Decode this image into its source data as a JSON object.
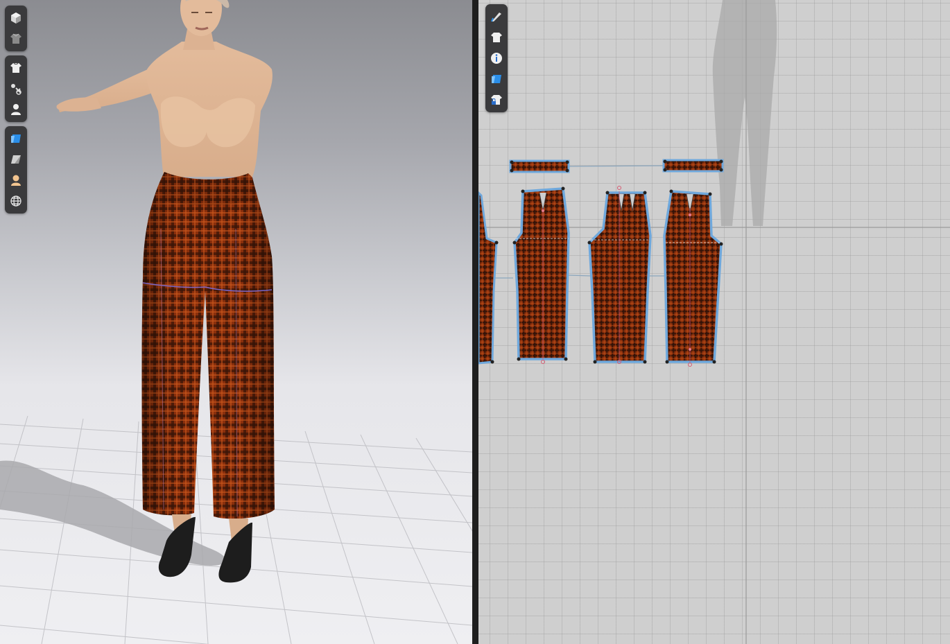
{
  "viewport_3d": {
    "toolbar_groups": [
      {
        "icons": [
          "3d-cube-display-icon",
          "garment-display-icon"
        ]
      },
      {
        "icons": [
          "show-garment-icon",
          "pin-tool-icon",
          "show-avatar-icon"
        ]
      },
      {
        "icons": [
          "texture-display-icon",
          "fabric-surface-icon",
          "avatar-skin-icon",
          "environment-globe-icon"
        ]
      }
    ]
  },
  "viewport_2d": {
    "toolbar_icons": [
      "edit-pattern-icon",
      "show-garment-2d-icon",
      "info-icon",
      "texture-2d-icon",
      "lock-garment-icon"
    ]
  },
  "colors": {
    "fabric_base": "#8a2f0c",
    "fabric_dark": "#2a1208",
    "fabric_light": "#c2521a",
    "outline_selected": "#6fa8dc",
    "toolbar_bg": "#3a3a3c",
    "accent_blue": "#2a8ee8"
  }
}
